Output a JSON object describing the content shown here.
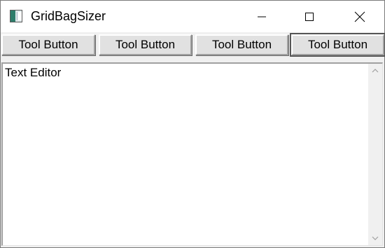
{
  "window": {
    "title": "GridBagSizer",
    "app_icon": "window-app-icon",
    "controls": {
      "minimize_icon": "minimize-icon",
      "maximize_icon": "maximize-icon",
      "close_icon": "close-icon"
    }
  },
  "toolbar": {
    "buttons": [
      {
        "label": "Tool Button"
      },
      {
        "label": "Tool Button"
      },
      {
        "label": "Tool Button"
      },
      {
        "label": "Tool Button",
        "focused": true
      }
    ]
  },
  "editor": {
    "text": "Text Editor",
    "scroll_up_icon": "chevron-up-icon",
    "scroll_down_icon": "chevron-down-icon"
  },
  "colors": {
    "window_bg": "#f0f0f0",
    "titlebar_bg": "#ffffff",
    "button_face": "#e1e1e1",
    "editor_bg": "#ffffff"
  }
}
